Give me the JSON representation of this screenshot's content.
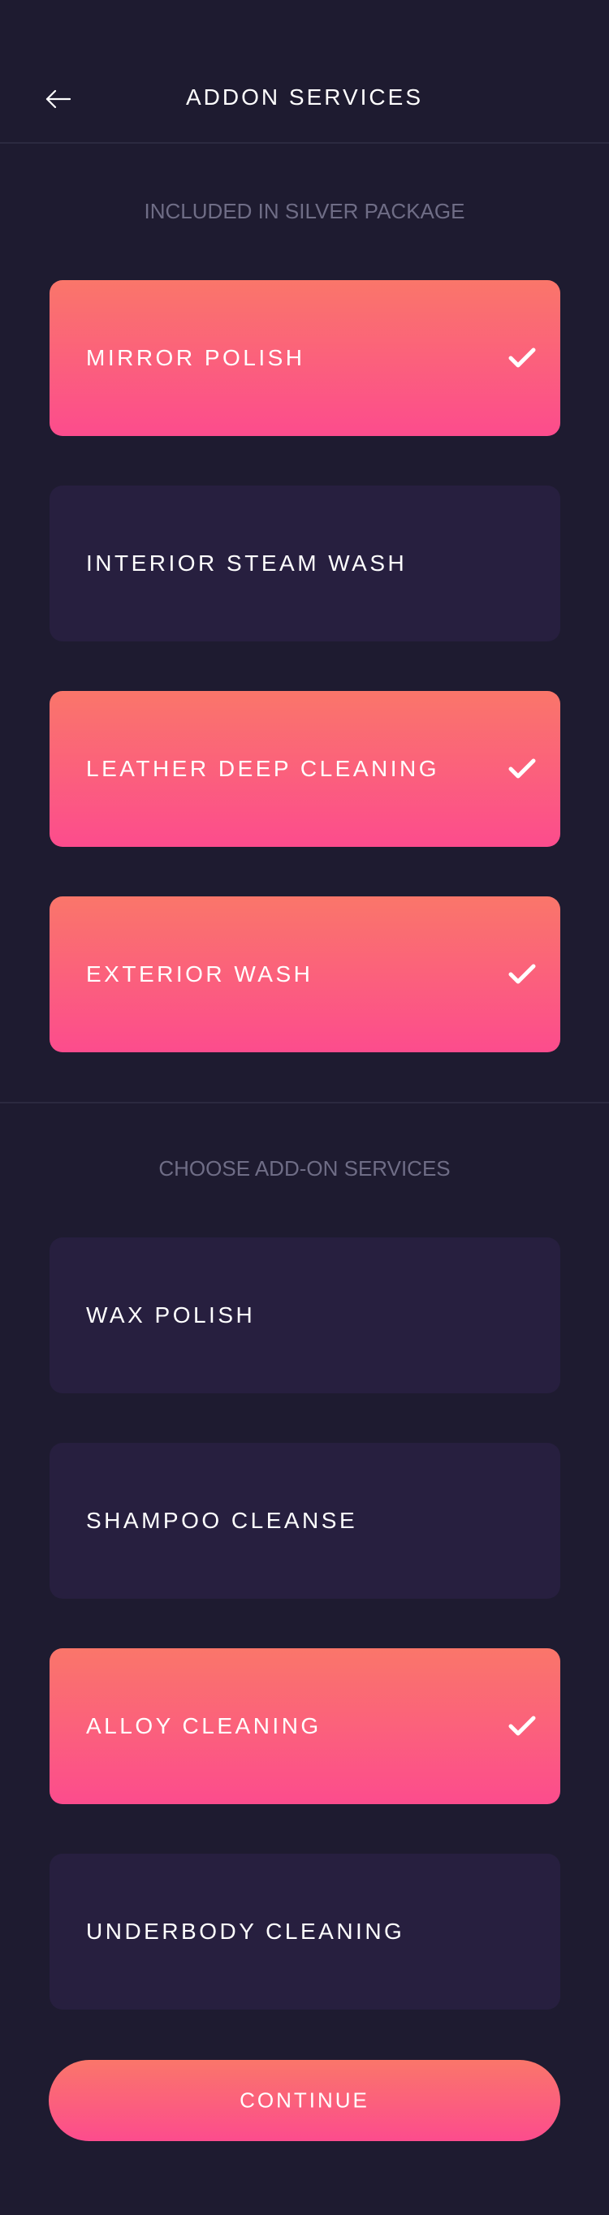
{
  "header": {
    "title": "ADDON SERVICES",
    "back_icon": "arrow-left-icon"
  },
  "included": {
    "label": "INCLUDED IN SILVER PACKAGE",
    "items": [
      {
        "label": "MIRROR POLISH",
        "selected": true
      },
      {
        "label": "INTERIOR STEAM WASH",
        "selected": false
      },
      {
        "label": "LEATHER DEEP CLEANING",
        "selected": true
      },
      {
        "label": "EXTERIOR WASH",
        "selected": true
      }
    ]
  },
  "addons": {
    "label": "CHOOSE ADD-ON SERVICES",
    "items": [
      {
        "label": "WAX POLISH",
        "selected": false
      },
      {
        "label": "SHAMPOO CLEANSE",
        "selected": false
      },
      {
        "label": "ALLOY CLEANING",
        "selected": true
      },
      {
        "label": "UNDERBODY CLEANING",
        "selected": false
      }
    ]
  },
  "continue_label": "CONTINUE",
  "colors": {
    "background": "#1e1b30",
    "card": "#271f3f",
    "accent_top": "#fa766a",
    "accent_bottom": "#fc4c8d",
    "muted_text": "#6f6d86"
  }
}
